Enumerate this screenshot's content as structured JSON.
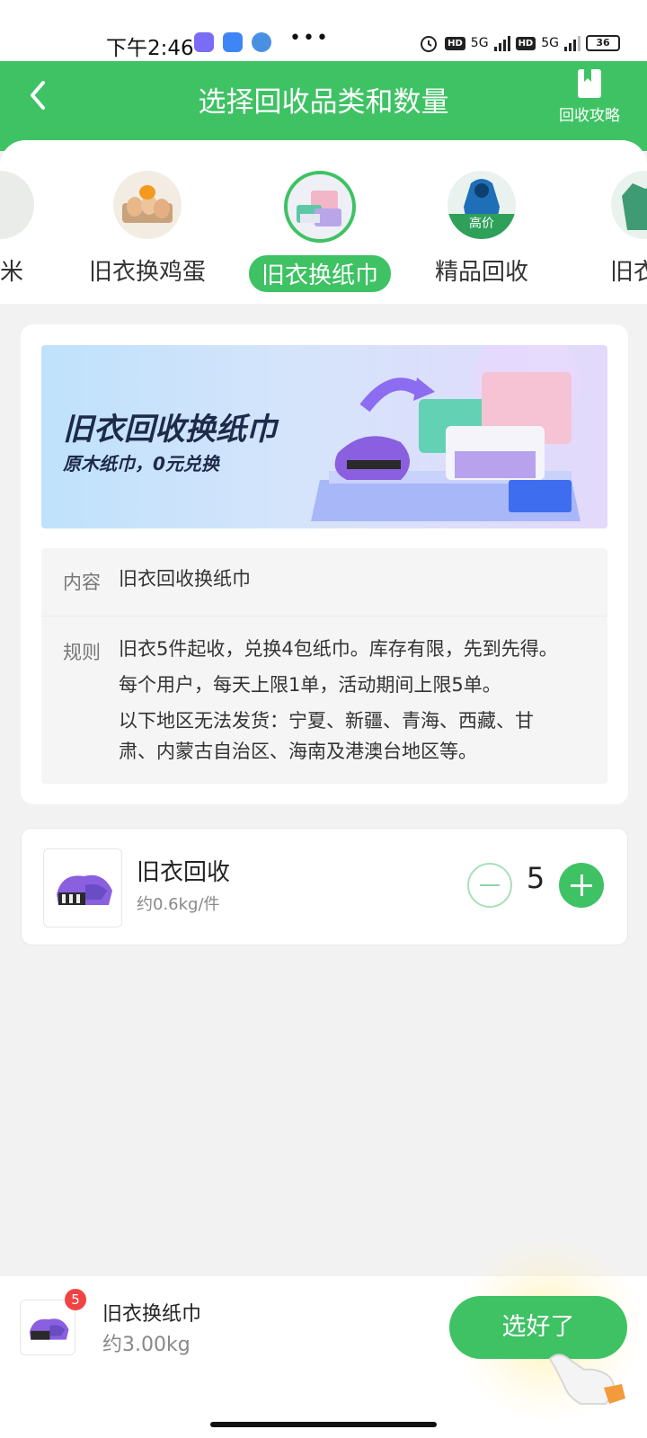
{
  "status_bar": {
    "time": "下午2:46",
    "dots": "•••",
    "network_a": "5G",
    "network_b": "5G",
    "hd": "HD",
    "battery": "36"
  },
  "header": {
    "title": "选择回收品类和数量",
    "guide_label": "回收攻略"
  },
  "categories": [
    {
      "label": "大米",
      "active": false
    },
    {
      "label": "旧衣换鸡蛋",
      "active": false
    },
    {
      "label": "旧衣换纸巾",
      "active": true
    },
    {
      "label": "精品回收",
      "active": false,
      "tag": "高价"
    },
    {
      "label": "旧衣回",
      "active": false
    }
  ],
  "banner": {
    "title": "旧衣回收换纸巾",
    "subtitle": "原木纸巾，0元兑换"
  },
  "details": {
    "content_label": "内容",
    "content_value": "旧衣回收换纸巾",
    "rules_label": "规则",
    "rules_lines": [
      "旧衣5件起收，兑换4包纸巾。库存有限，先到先得。",
      "每个用户，每天上限1单，活动期间上限5单。",
      "以下地区无法发货：宁夏、新疆、青海、西藏、甘",
      "肃、内蒙古自治区、海南及港澳台地区等。"
    ]
  },
  "item": {
    "name": "旧衣回收",
    "weight": "约0.6kg/件",
    "quantity": "5"
  },
  "bottom_bar": {
    "badge_count": "5",
    "name": "旧衣换纸巾",
    "weight": "约3.00kg",
    "done_label": "选好了"
  },
  "colors": {
    "brand_green": "#3ec264",
    "badge_red": "#f04444"
  }
}
